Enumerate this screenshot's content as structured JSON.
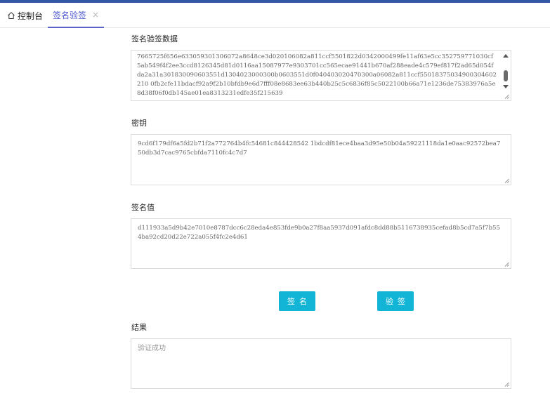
{
  "tabs": {
    "home_label": "控制台",
    "active_label": "签名验签",
    "close_glyph": "×"
  },
  "data_section": {
    "label": "签名验签数据",
    "value": "7665725f656e633059301306072a8648ce3d020106082a811ccf5501822d0342000499fe11af63e5cc352759771030cf5ab549f4f2ee3ccd8126345d81d0116aa15087977e9303701cc565ecae91441b670af288eade4c579ef817f2ad65d054fda2a31a301830090603551d1304023000300b0603551d0f040403020470300a06082a811ccf55018375034900304602210 0fb2cfe11bdacf92a9f2b10bfdb9e6d7fff08e8683ee63b440b25c5c6836f85c5022100b66a71e1236de75383976a5e8d38f06f0db145ae01ea8313231edfe35f215639"
  },
  "key_section": {
    "label": "密钥",
    "value": "9cd6f179df6a5fd2b71f2a772764b4fc54681c844428542 1bdcdf81ece4baa3d95e50b04a59221118da1e0aac92572bea750db3d7cac9765cbfda7110fc4c7d7"
  },
  "signature_section": {
    "label": "签名值",
    "value": "d111933a5d9b42e7010e8787dcc6c28eda4e853fde9b0a27f8aa5937d091afdc8dd88b5116738935cefad8b5cd7a5f7b554ba92cd20d22e722a055f4fc2e4d61"
  },
  "buttons": {
    "sign_label": "签名",
    "verify_label": "验签"
  },
  "result_section": {
    "label": "结果",
    "value": "验证成功"
  },
  "colors": {
    "accent": "#13b5d6",
    "topbar": "#2f57a4",
    "tab_active": "#4e5bd0"
  }
}
